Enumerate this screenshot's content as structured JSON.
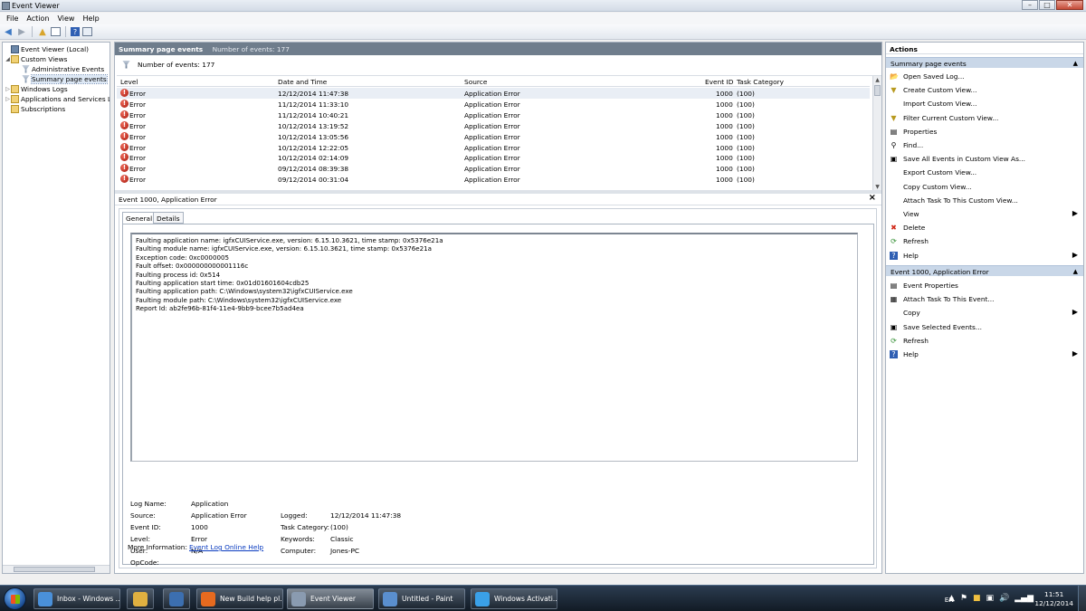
{
  "window": {
    "title": "Event Viewer"
  },
  "menu": [
    "File",
    "Action",
    "View",
    "Help"
  ],
  "tree": {
    "items": [
      {
        "label": "Event Viewer (Local)",
        "exp": "",
        "icon": "computer-icon"
      },
      {
        "label": "Custom Views",
        "exp": "◢",
        "icon": "folder-icon"
      },
      {
        "label": "Administrative Events",
        "exp": "",
        "icon": "filter-icon"
      },
      {
        "label": "Summary page events",
        "exp": "",
        "icon": "filter-icon",
        "selected": true
      },
      {
        "label": "Windows Logs",
        "exp": "▷",
        "icon": "folder-icon"
      },
      {
        "label": "Applications and Services Lo",
        "exp": "▷",
        "icon": "folder-icon"
      },
      {
        "label": "Subscriptions",
        "exp": "",
        "icon": "folder-icon"
      }
    ]
  },
  "center": {
    "header_title": "Summary page events",
    "header_count": "Number of events: 177",
    "filter_text": "Number of events: 177",
    "columns": [
      "Level",
      "Date and Time",
      "Source",
      "Event ID",
      "Task Category"
    ],
    "rows": [
      {
        "level": "Error",
        "datetime": "12/12/2014 11:47:38",
        "source": "Application Error",
        "event_id": "1000",
        "category": "(100)"
      },
      {
        "level": "Error",
        "datetime": "11/12/2014 11:33:10",
        "source": "Application Error",
        "event_id": "1000",
        "category": "(100)"
      },
      {
        "level": "Error",
        "datetime": "11/12/2014 10:40:21",
        "source": "Application Error",
        "event_id": "1000",
        "category": "(100)"
      },
      {
        "level": "Error",
        "datetime": "10/12/2014 13:19:52",
        "source": "Application Error",
        "event_id": "1000",
        "category": "(100)"
      },
      {
        "level": "Error",
        "datetime": "10/12/2014 13:05:56",
        "source": "Application Error",
        "event_id": "1000",
        "category": "(100)"
      },
      {
        "level": "Error",
        "datetime": "10/12/2014 12:22:05",
        "source": "Application Error",
        "event_id": "1000",
        "category": "(100)"
      },
      {
        "level": "Error",
        "datetime": "10/12/2014 02:14:09",
        "source": "Application Error",
        "event_id": "1000",
        "category": "(100)"
      },
      {
        "level": "Error",
        "datetime": "09/12/2014 08:39:38",
        "source": "Application Error",
        "event_id": "1000",
        "category": "(100)"
      },
      {
        "level": "Error",
        "datetime": "09/12/2014 00:31:04",
        "source": "Application Error",
        "event_id": "1000",
        "category": "(100)"
      }
    ]
  },
  "detail": {
    "title": "Event 1000, Application Error",
    "close_glyph": "×",
    "tabs": [
      "General",
      "Details"
    ],
    "description": [
      "Faulting application name: igfxCUIService.exe, version: 6.15.10.3621, time stamp: 0x5376e21a",
      "Faulting module name: igfxCUIService.exe, version: 6.15.10.3621, time stamp: 0x5376e21a",
      "Exception code: 0xc0000005",
      "Fault offset: 0x000000000001116c",
      "Faulting process id: 0x514",
      "Faulting application start time: 0x01d01601604cdb25",
      "Faulting application path: C:\\Windows\\system32\\igfxCUIService.exe",
      "Faulting module path: C:\\Windows\\system32\\igfxCUIService.exe",
      "Report Id: ab2fe96b-81f4-11e4-9bb9-bcee7b5ad4ea"
    ],
    "props": {
      "log_name_label": "Log Name:",
      "log_name": "Application",
      "source_label": "Source:",
      "source": "Application Error",
      "logged_label": "Logged:",
      "logged": "12/12/2014 11:47:38",
      "event_id_label": "Event ID:",
      "event_id": "1000",
      "task_category_label": "Task Category:",
      "task_category": "(100)",
      "level_label": "Level:",
      "level": "Error",
      "keywords_label": "Keywords:",
      "keywords": "Classic",
      "user_label": "User:",
      "user": "N/A",
      "computer_label": "Computer:",
      "computer": "Jones-PC",
      "opcode_label": "OpCode:",
      "opcode": "",
      "more_info_label": "More Information:",
      "more_info_link": "Event Log Online Help"
    }
  },
  "actions": {
    "title": "Actions",
    "section1": "Summary page events",
    "items1": [
      {
        "label": "Open Saved Log...",
        "icon": "open-folder-icon",
        "glyph": "📂",
        "sub": false
      },
      {
        "label": "Create Custom View...",
        "icon": "filter-add-icon",
        "glyph": "▼",
        "sub": false
      },
      {
        "label": "Import Custom View...",
        "icon": "import-icon",
        "glyph": "",
        "sub": false
      },
      {
        "label": "Filter Current Custom View...",
        "icon": "filter-icon",
        "glyph": "▼",
        "sub": false
      },
      {
        "label": "Properties",
        "icon": "properties-icon",
        "glyph": "▤",
        "sub": false
      },
      {
        "label": "Find...",
        "icon": "find-icon",
        "glyph": "⚲",
        "sub": false
      },
      {
        "label": "Save All Events in Custom View As...",
        "icon": "save-icon",
        "glyph": "▣",
        "sub": false
      },
      {
        "label": "Export Custom View...",
        "icon": "export-icon",
        "glyph": "",
        "sub": false
      },
      {
        "label": "Copy Custom View...",
        "icon": "copy-icon",
        "glyph": "",
        "sub": false
      },
      {
        "label": "Attach Task To This Custom View...",
        "icon": "attach-task-icon",
        "glyph": "",
        "sub": false
      },
      {
        "label": "View",
        "icon": "view-icon",
        "glyph": "",
        "sub": true
      },
      {
        "label": "Delete",
        "icon": "delete-icon",
        "glyph": "✖",
        "sub": false
      },
      {
        "label": "Refresh",
        "icon": "refresh-icon",
        "glyph": "⟳",
        "sub": false
      },
      {
        "label": "Help",
        "icon": "help-icon",
        "glyph": "?",
        "sub": true
      }
    ],
    "section2": "Event 1000, Application Error",
    "items2": [
      {
        "label": "Event Properties",
        "icon": "event-properties-icon",
        "glyph": "▤",
        "sub": false
      },
      {
        "label": "Attach Task To This Event...",
        "icon": "attach-task-icon",
        "glyph": "▦",
        "sub": false
      },
      {
        "label": "Copy",
        "icon": "copy-icon",
        "glyph": "",
        "sub": true
      },
      {
        "label": "Save Selected Events...",
        "icon": "save-icon",
        "glyph": "▣",
        "sub": false
      },
      {
        "label": "Refresh",
        "icon": "refresh-icon",
        "glyph": "⟳",
        "sub": false
      },
      {
        "label": "Help",
        "icon": "help-icon",
        "glyph": "?",
        "sub": true
      }
    ],
    "caret": "▲",
    "submenu_glyph": "▶"
  },
  "taskbar": {
    "buttons": [
      {
        "label": "Inbox - Windows ...",
        "icon_color": "#4a90d9"
      },
      {
        "label": "",
        "icon_color": "#e0b040",
        "pin": true
      },
      {
        "label": "",
        "icon_color": "#3c6fb0",
        "pin": true
      },
      {
        "label": "New Build help pl...",
        "icon_color": "#e66a1f"
      },
      {
        "label": "Event Viewer",
        "icon_color": "#8a9bb0",
        "active": true
      },
      {
        "label": "Untitled - Paint",
        "icon_color": "#5a8fcf"
      },
      {
        "label": "Windows Activati...",
        "icon_color": "#3aa0e8"
      }
    ],
    "lang": "EN",
    "time": "11:51",
    "date": "12/12/2014"
  }
}
